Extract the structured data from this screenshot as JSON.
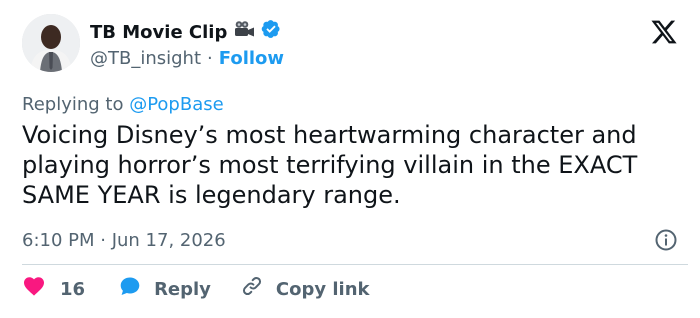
{
  "author": {
    "display_name": "TB Movie Clip",
    "handle": "@TB_insight",
    "follow_label": "Follow",
    "separator": "·",
    "name_emoji_icon": "movie-camera-icon",
    "verified_icon": "verified-badge-icon"
  },
  "header": {
    "logo_icon": "x-logo-icon"
  },
  "reply_context": {
    "prefix": "Replying to ",
    "mention": "@PopBase"
  },
  "tweet": {
    "text": "Voicing Disney’s most heartwarming character and\nplaying horror’s most terrifying villain in the EXACT\nSAME YEAR is legendary range.",
    "timestamp": "6:10 PM · Jun 17, 2026",
    "info_icon": "info-icon"
  },
  "actions": {
    "like_count": "16",
    "reply_label": "Reply",
    "copy_label": "Copy link",
    "like_icon": "heart-icon",
    "reply_icon": "reply-bubble-icon",
    "copy_icon": "link-icon"
  },
  "colors": {
    "accent": "#1d9bf0",
    "text": "#0f1419",
    "secondary": "#536471",
    "like": "#f91880",
    "divider": "#cfd9de"
  }
}
